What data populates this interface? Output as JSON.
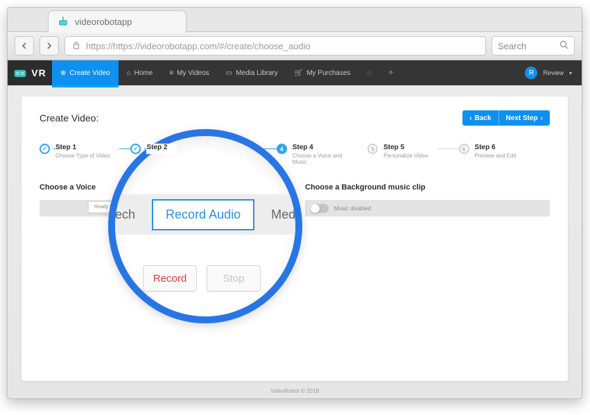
{
  "browser": {
    "tab_title": "videorobotapp",
    "url": "https://https://videorobotapp.com/#/create/choose_audio",
    "search_placeholder": "Search"
  },
  "nav": {
    "create": "Create Video",
    "home": "Home",
    "my_videos": "My Videos",
    "media_library": "Media Library",
    "my_purchases": "My Purchases",
    "avatar_letter": "R",
    "review": "Review"
  },
  "page": {
    "title": "Create Video:",
    "back": "Back",
    "next": "Next Step"
  },
  "steps": [
    {
      "label": "Step 1",
      "sub": "Choose Type of Video"
    },
    {
      "label": "Step 2",
      "sub": ""
    },
    {
      "label": "Step 4",
      "sub": "Choose a Voice and Music"
    },
    {
      "label": "Step 5",
      "sub": "Personalize Video"
    },
    {
      "label": "Step 6",
      "sub": "Preview and Edit"
    }
  ],
  "voice": {
    "heading": "Choose a Voice",
    "chip": "Ready Made Vo"
  },
  "music": {
    "heading": "Choose a Background music clip",
    "label": "Music disabled"
  },
  "magnifier": {
    "tab_left_fragment": "eech",
    "tab_active": "Record Audio",
    "tab_right_fragment": "Med",
    "record": "Record",
    "stop": "Stop"
  },
  "footer": "VideoRobot © 2018"
}
